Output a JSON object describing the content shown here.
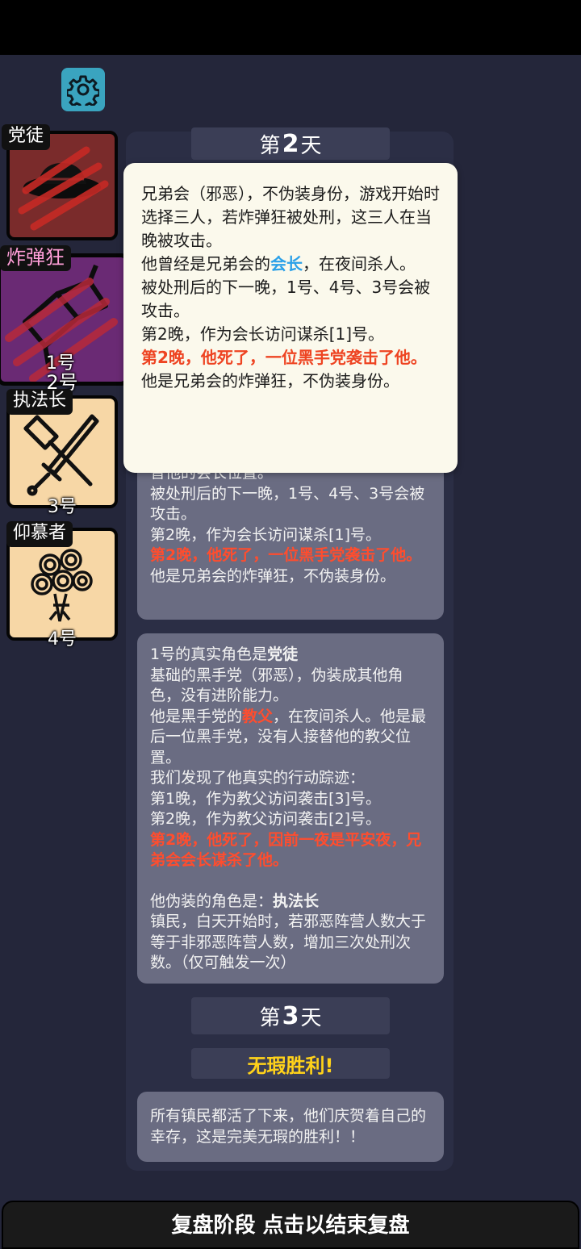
{
  "settings": {
    "icon": "gear-icon"
  },
  "roles": [
    {
      "tag": "党徒",
      "number": "1号",
      "bg": "#7a2b2b",
      "icon": "hat-icon"
    },
    {
      "tag": "炸弹狂",
      "number": "2号",
      "bg": "#6a2a74",
      "icon": "bomb-icon"
    },
    {
      "tag": "执法长",
      "number": "3号",
      "bg": "#f7d7a6",
      "icon": "hammer-sword-icon"
    },
    {
      "tag": "仰慕者",
      "number": "4号",
      "bg": "#f7d7a6",
      "icon": "bouquet-icon"
    }
  ],
  "log": {
    "day2_label": {
      "prefix": "第",
      "num": "2",
      "suffix": "天"
    },
    "day3_label": {
      "prefix": "第",
      "num": "3",
      "suffix": "天"
    },
    "victory": "无瑕胜利!",
    "msg_bomber": {
      "l1": "替他的会长位置。",
      "l2": "被处刑后的下一晚，1号、4号、3号会被攻击。",
      "l3": "第2晚，作为会长访问谋杀[1]号。",
      "l4": "第2晚，他死了，一位黑手党袭击了他。",
      "l5": "他是兄弟会的炸弹狂，不伪装身份。"
    },
    "msg_partisan": {
      "l1a": "1号的真实角色是",
      "l1b": "党徒",
      "l2": "基础的黑手党（邪恶），伪装成其他角色，没有进阶能力。",
      "l3a": "他是黑手党的",
      "l3b": "教父",
      "l3c": "，在夜间杀人。他是最后一位黑手党，没有人接替他的教父位置。",
      "l4": "我们发现了他真实的行动踪迹：",
      "l5": "第1晚，作为教父访问袭击[3]号。",
      "l6": "第2晚，作为教父访问袭击[2]号。",
      "l7": "第2晚，他死了，因前一夜是平安夜，兄弟会会长谋杀了他。",
      "l8a": "他伪装的角色是：",
      "l8b": "执法长",
      "l9": "镇民，白天开始时，若邪恶阵营人数大于等于非邪恶阵营人数，增加三次处刑次数。（仅可触发一次）"
    },
    "msg_final": "所有镇民都活了下来，他们庆贺着自己的幸存，这是完美无瑕的胜利！！"
  },
  "tooltip": {
    "l1": "兄弟会（邪恶），不伪装身份，游戏开始时选择三人，若炸弹狂被处刑，这三人在当晚被攻击。",
    "l2a": "他曾经是兄弟会的",
    "l2b": "会长",
    "l2c": "，在夜间杀人。",
    "l3": "被处刑后的下一晚，1号、4号、3号会被攻击。",
    "l4": "第2晚，作为会长访问谋杀[1]号。",
    "l5": "第2晚，他死了，一位黑手党袭击了他。",
    "l6": "他是兄弟会的炸弹狂，不伪装身份。"
  },
  "footer": {
    "label": "复盘阶段 点击以结束复盘"
  }
}
